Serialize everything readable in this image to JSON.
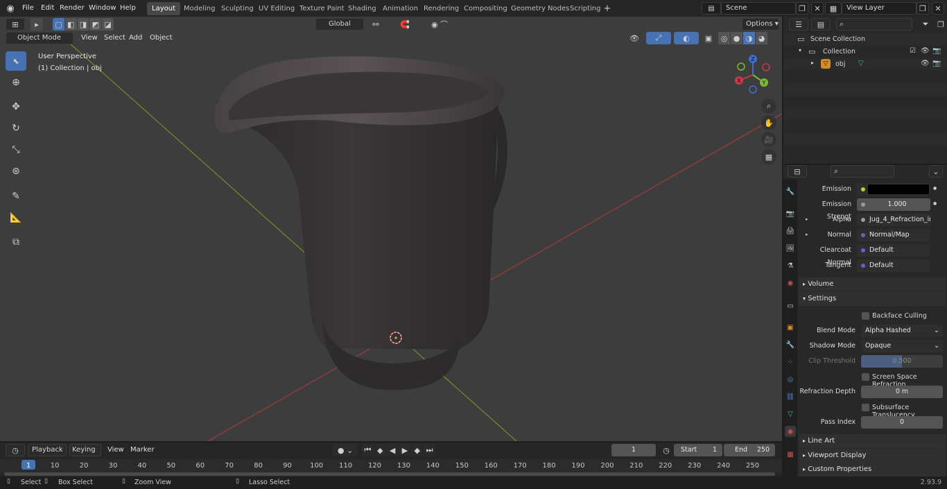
{
  "menu": [
    "File",
    "Edit",
    "Render",
    "Window",
    "Help"
  ],
  "workspaces": [
    "Layout",
    "Modeling",
    "Sculpting",
    "UV Editing",
    "Texture Paint",
    "Shading",
    "Animation",
    "Rendering",
    "Compositing",
    "Geometry Nodes",
    "Scripting"
  ],
  "active_workspace": "Layout",
  "scene": {
    "label": "Scene",
    "view_layer": "View Layer"
  },
  "viewport": {
    "mode": "Object Mode",
    "menu": [
      "View",
      "Select",
      "Add",
      "Object"
    ],
    "orientation": "Global",
    "options": "Options",
    "perspective": "User Perspective",
    "collection_info": "(1) Collection | obj"
  },
  "gizmo": {
    "z": "Z",
    "y": "Y",
    "x": "X"
  },
  "outliner": {
    "scene_collection": "Scene Collection",
    "collection": "Collection",
    "object": "obj"
  },
  "properties": {
    "rows": [
      {
        "label": "Emission",
        "value": "",
        "kind": "color",
        "dot": "#c7c739"
      },
      {
        "label": "Emission Strengt",
        "value": "1.000",
        "kind": "number",
        "dot": "#9a9a9a"
      },
      {
        "label": "Alpha",
        "value": "Jug_4_Refraction_in...",
        "kind": "link",
        "dot": "#9a9a9a"
      },
      {
        "label": "Normal",
        "value": "Normal/Map",
        "kind": "link",
        "dot": "#6363c7"
      },
      {
        "label": "Clearcoat Normal",
        "value": "Default",
        "kind": "link",
        "dot": "#6363c7"
      },
      {
        "label": "Tangent",
        "value": "Default",
        "kind": "link",
        "dot": "#6363c7"
      }
    ],
    "volume": "Volume",
    "settings": "Settings",
    "backface": "Backface Culling",
    "blend_mode_label": "Blend Mode",
    "blend_mode": "Alpha Hashed",
    "shadow_mode_label": "Shadow Mode",
    "shadow_mode": "Opaque",
    "clip_label": "Clip Threshold",
    "clip_value": "0.500",
    "clip_fraction": 0.5,
    "ssr": "Screen Space Refraction",
    "refraction_label": "Refraction Depth",
    "refraction_value": "0 m",
    "subsurface": "Subsurface Translucency",
    "pass_label": "Pass Index",
    "pass_value": "0",
    "line_art": "Line Art",
    "viewport_display": "Viewport Display",
    "custom_props": "Custom Properties"
  },
  "timeline": {
    "menu": [
      "Playback",
      "Keying",
      "View",
      "Marker"
    ],
    "current_frame": "1",
    "start_label": "Start",
    "start": "1",
    "end_label": "End",
    "end": "250",
    "ticks": [
      "1",
      "10",
      "20",
      "30",
      "40",
      "50",
      "60",
      "70",
      "80",
      "90",
      "100",
      "110",
      "120",
      "130",
      "140",
      "150",
      "160",
      "170",
      "180",
      "190",
      "200",
      "210",
      "220",
      "230",
      "240",
      "250"
    ]
  },
  "status": {
    "select": "Select",
    "box_select": "Box Select",
    "zoom": "Zoom View",
    "lasso": "Lasso Select",
    "version": "2.93.9"
  }
}
